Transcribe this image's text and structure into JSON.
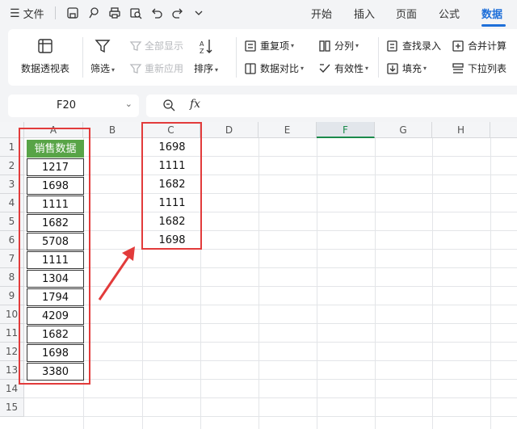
{
  "menu": {
    "file_label": "文件",
    "tabs": [
      "开始",
      "插入",
      "页面",
      "公式",
      "数据"
    ],
    "active_tab": "数据"
  },
  "ribbon": {
    "pivot": "数据透视表",
    "filter": "筛选",
    "show_all": "全部显示",
    "reapply": "重新应用",
    "sort": "排序",
    "duplicates": "重复项",
    "compare": "数据对比",
    "split": "分列",
    "validity": "有效性",
    "lookup": "查找录入",
    "fill": "填充",
    "consolidate": "合并计算",
    "dropdown": "下拉列表"
  },
  "formula_bar": {
    "name_box": "F20",
    "fx": "fx",
    "formula": ""
  },
  "grid": {
    "columns": [
      "A",
      "B",
      "C",
      "D",
      "E",
      "F",
      "G",
      "H"
    ],
    "selected_column": "F",
    "rows": [
      "1",
      "2",
      "3",
      "4",
      "5",
      "6",
      "7",
      "8",
      "9",
      "10",
      "11",
      "12",
      "13",
      "14",
      "15"
    ],
    "column_a": [
      "销售数据",
      "1217",
      "1698",
      "1111",
      "1682",
      "5708",
      "1111",
      "1304",
      "1794",
      "4209",
      "1682",
      "1698",
      "3380"
    ],
    "column_c": [
      "1698",
      "1111",
      "1682",
      "1111",
      "1682",
      "1698"
    ]
  },
  "colors": {
    "accent": "#1e6fd9",
    "header_fill": "#58a447",
    "highlight": "#e23b3b",
    "selected_col": "#1a8a4a"
  }
}
